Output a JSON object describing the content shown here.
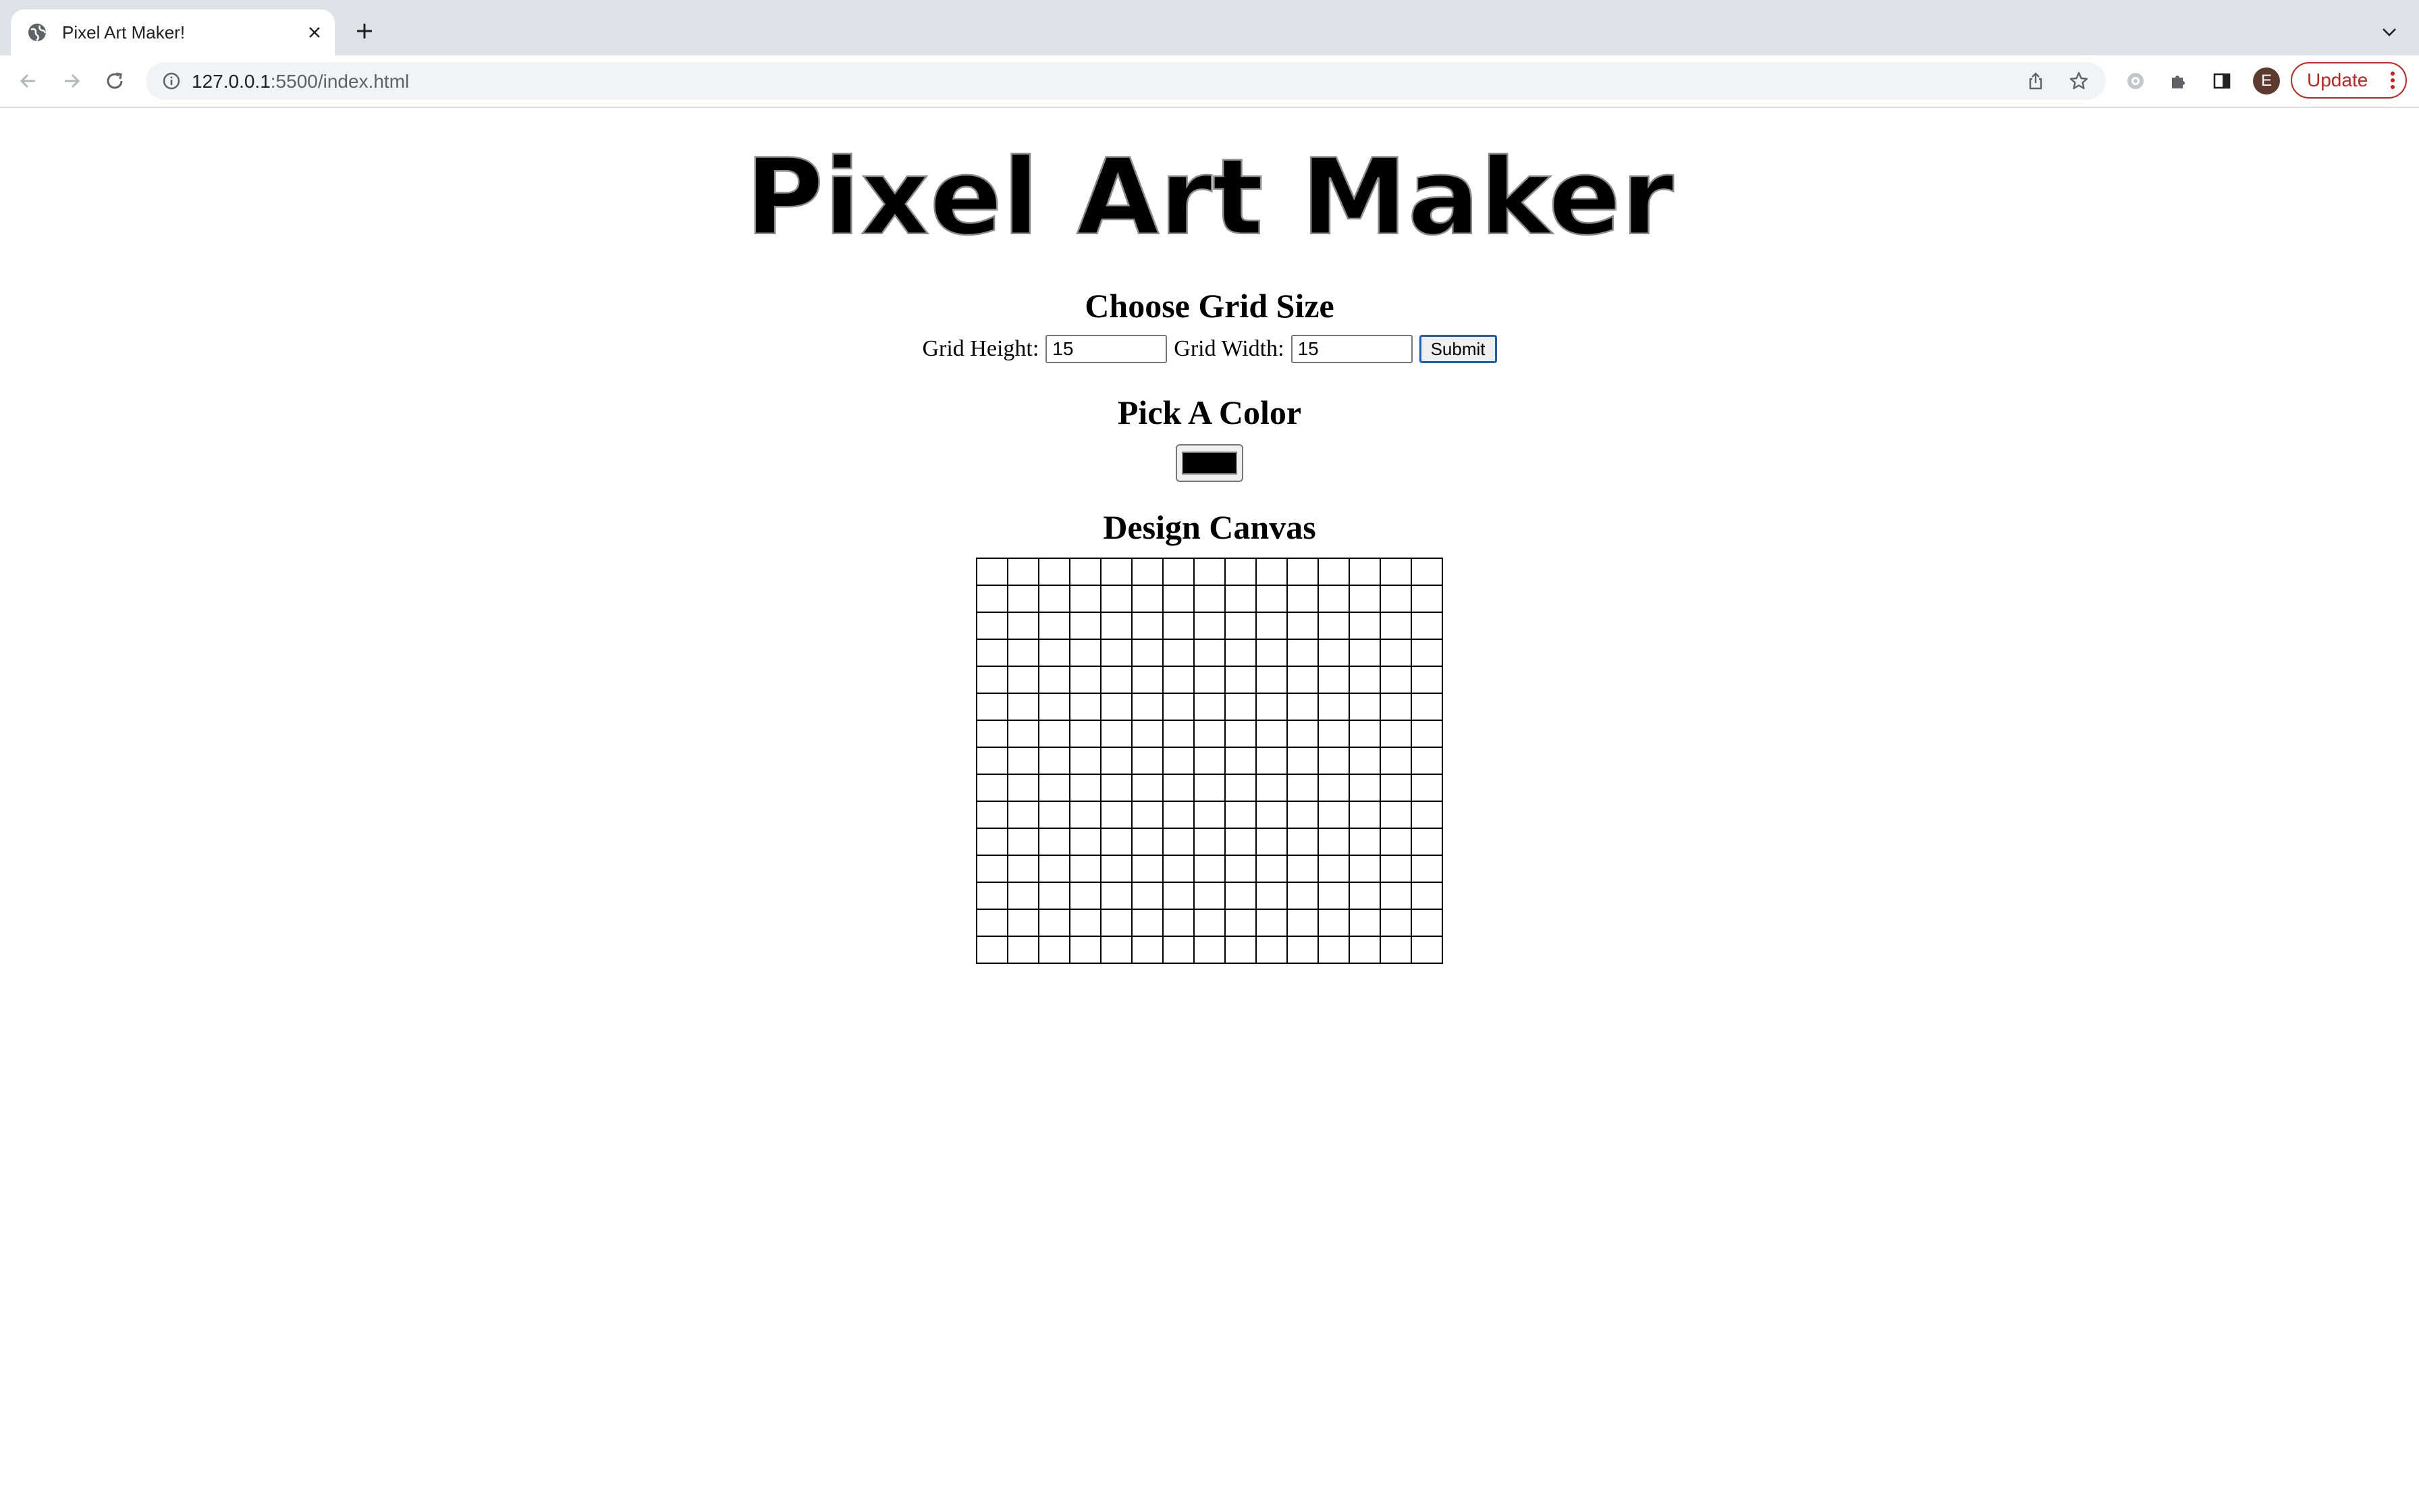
{
  "browser": {
    "tab_title": "Pixel Art Maker!",
    "url_host": "127.0.0.1",
    "url_path": ":5500/index.html",
    "avatar_letter": "E",
    "update_label": "Update",
    "icons": [
      "back-icon",
      "forward-icon",
      "reload-icon",
      "info-icon",
      "share-icon",
      "star-icon",
      "extensions-icon",
      "sidepanel-icon",
      "globe-icon",
      "close-icon",
      "plus-icon",
      "chevron-down-icon",
      "more-icon"
    ]
  },
  "page": {
    "logo_text": "Pixel Art Maker",
    "grid_section_title": "Choose Grid Size",
    "height_label": "Grid Height:",
    "height_value": "15",
    "width_label": "Grid Width:",
    "width_value": "15",
    "submit_label": "Submit",
    "color_section_title": "Pick A Color",
    "selected_color": "#000000",
    "canvas_title": "Design Canvas",
    "grid_rows": 15,
    "grid_cols": 15
  }
}
